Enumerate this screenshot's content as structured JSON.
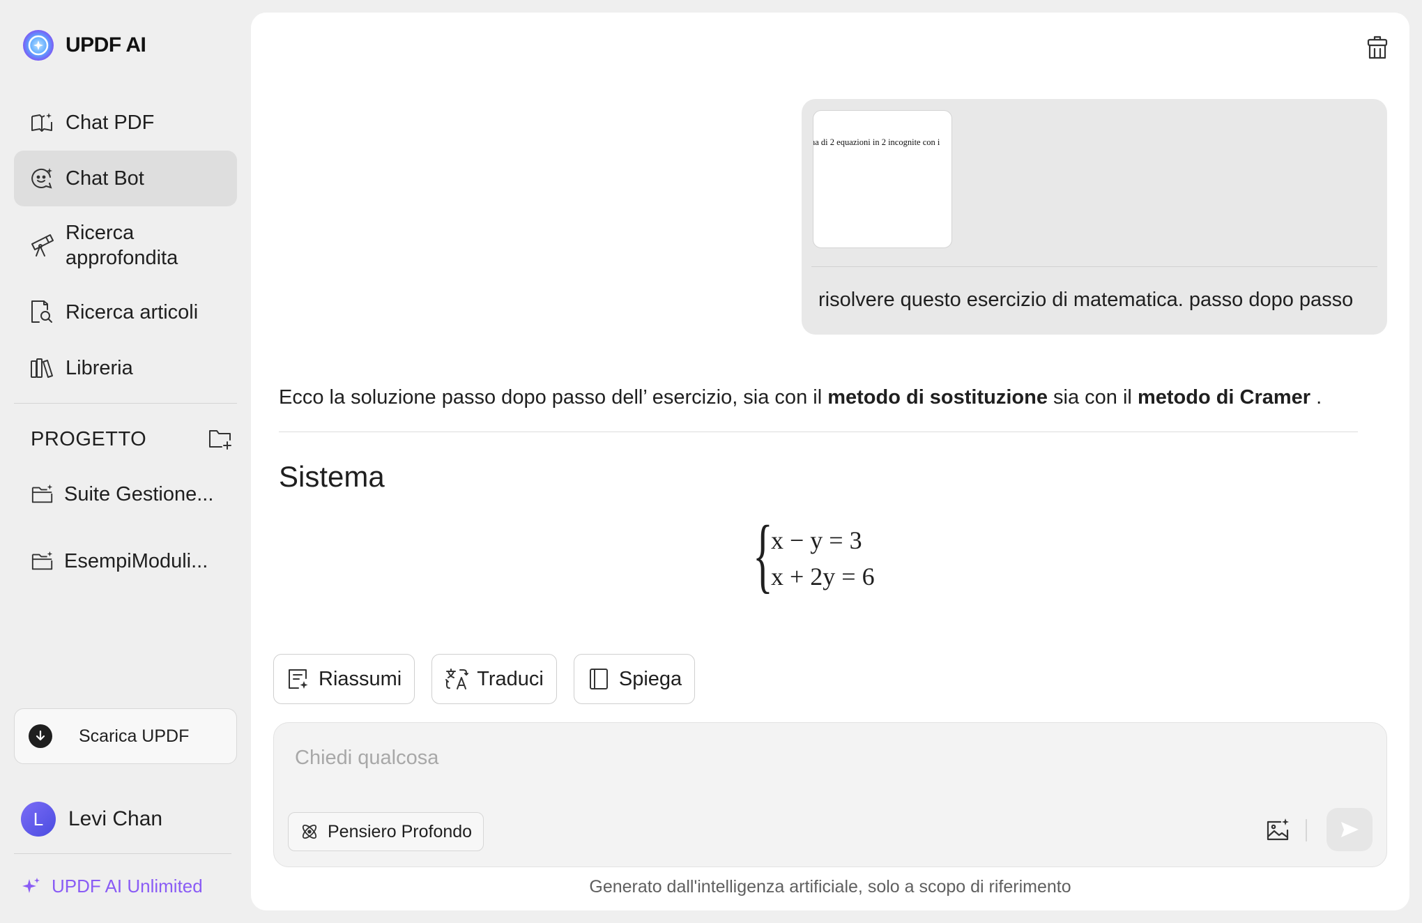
{
  "brand": {
    "name": "UPDF AI"
  },
  "sidebar": {
    "items": [
      {
        "label": "Chat PDF",
        "icon": "book-sparkle-icon"
      },
      {
        "label": "Chat Bot",
        "icon": "bot-face-icon",
        "active": true
      },
      {
        "label": "Ricerca approfondita",
        "icon": "telescope-icon"
      },
      {
        "label": "Ricerca articoli",
        "icon": "doc-search-icon"
      },
      {
        "label": "Libreria",
        "icon": "library-icon"
      }
    ],
    "project_title": "PROGETTO",
    "projects": [
      {
        "label": "Suite Gestione..."
      },
      {
        "label": "EsempiModuli..."
      }
    ],
    "download_label": "Scarica UPDF",
    "user": {
      "name": "Levi Chan",
      "initial": "L"
    },
    "unlimited_label": "UPDF AI Unlimited"
  },
  "chat": {
    "user_message": {
      "attachment_snippet": "na di 2 equazioni in 2 incognite con i",
      "text": "risolvere questo esercizio di matematica. passo dopo passo"
    },
    "answer": {
      "intro_pre": "Ecco la soluzione passo dopo passo dell’  esercizio, sia con il ",
      "intro_bold1": "metodo di sostituzione",
      "intro_mid": " sia con il ",
      "intro_bold2": "metodo di Cramer",
      "intro_post": " .",
      "section_title": "Sistema",
      "equations": [
        "x − y = 3",
        "x + 2y = 6"
      ]
    }
  },
  "quick_actions": [
    {
      "label": "Riassumi",
      "icon": "summary-icon"
    },
    {
      "label": "Traduci",
      "icon": "translate-icon"
    },
    {
      "label": "Spiega",
      "icon": "book-icon"
    }
  ],
  "composer": {
    "placeholder": "Chiedi qualcosa",
    "value": "",
    "deep_think_label": "Pensiero Profondo"
  },
  "disclaimer": "Generato dall'intelligenza artificiale, solo a scopo di riferimento",
  "colors": {
    "accent": "#8a5cf5",
    "sidebar_bg": "#efefef",
    "active_item_bg": "#dedede",
    "user_bubble_bg": "#e8e8e8"
  }
}
